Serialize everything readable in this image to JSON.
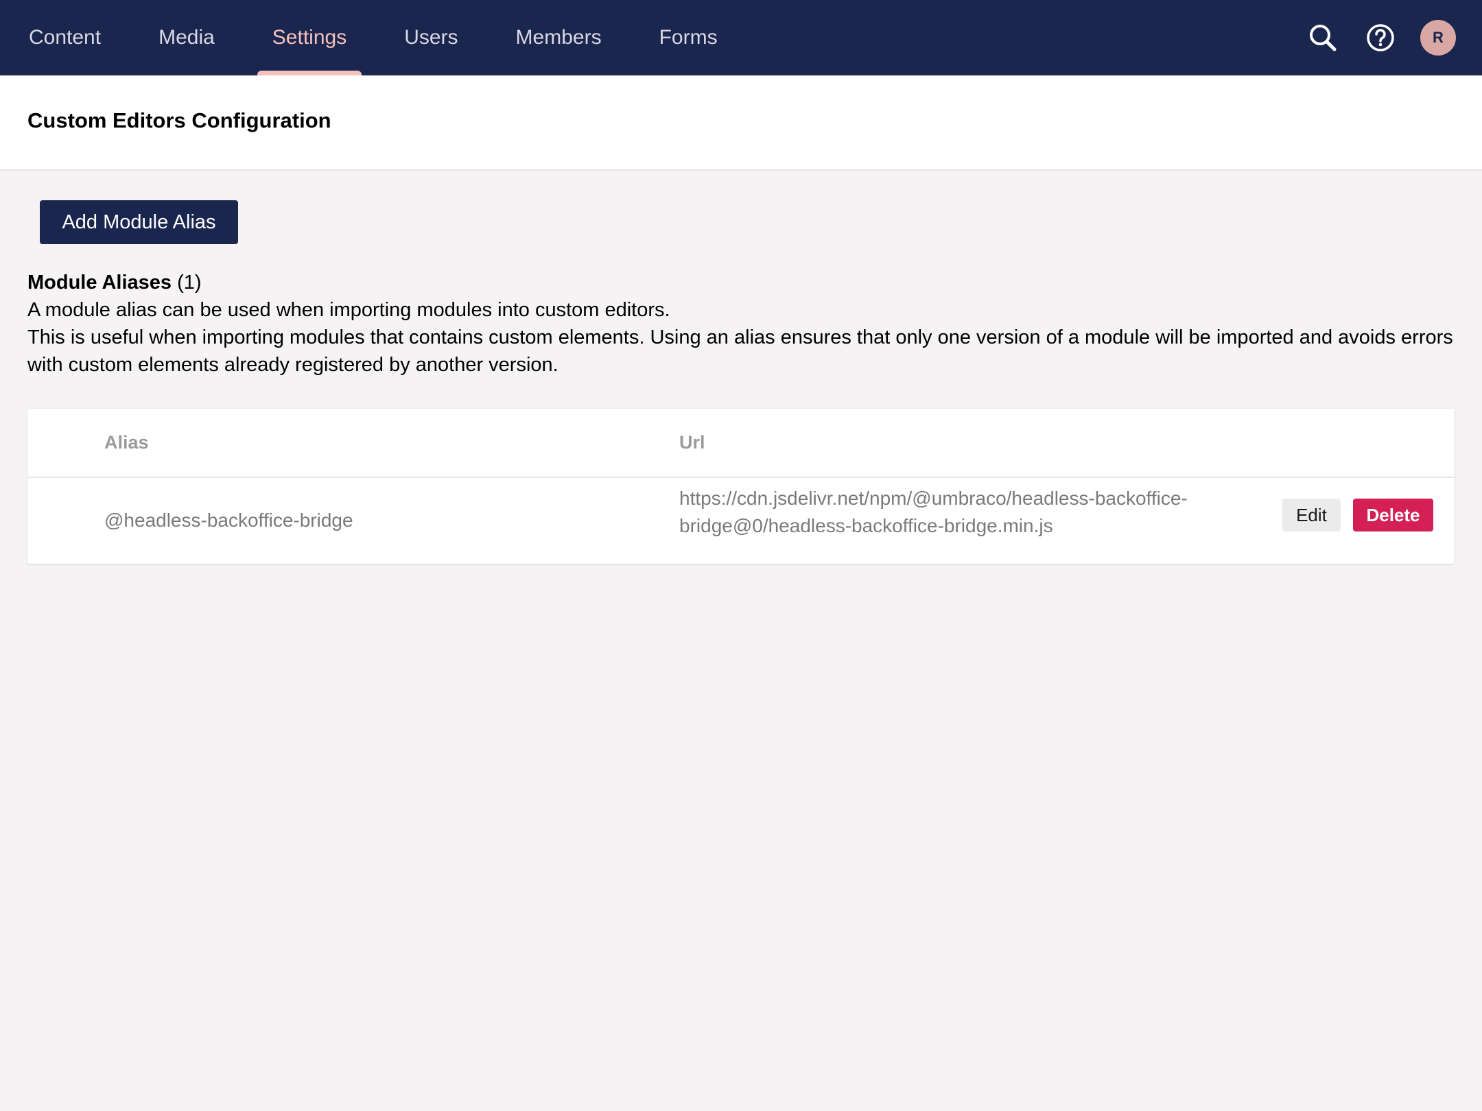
{
  "nav": {
    "items": [
      {
        "label": "Content"
      },
      {
        "label": "Media"
      },
      {
        "label": "Settings"
      },
      {
        "label": "Users"
      },
      {
        "label": "Members"
      },
      {
        "label": "Forms"
      }
    ],
    "active": "Settings"
  },
  "top_actions": {
    "search_icon": "search-icon",
    "help_icon": "help-icon",
    "avatar_initial": "R"
  },
  "header": {
    "title": "Custom Editors Configuration"
  },
  "toolbar": {
    "add_label": "Add Module Alias"
  },
  "section": {
    "heading": "Module Aliases",
    "count": "(1)",
    "description_1": "A module alias can be used when importing modules into custom editors.",
    "description_2": "This is useful when importing modules that contains custom elements. Using an alias ensures that only one version of a module will be imported and avoids errors with custom elements already registered by another version."
  },
  "table": {
    "columns": [
      "Alias",
      "Url"
    ],
    "rows": [
      {
        "alias": "@headless-backoffice-bridge",
        "url": "https://cdn.jsdelivr.net/npm/@umbraco/headless-backoffice-bridge@0/headless-backoffice-bridge.min.js",
        "edit_label": "Edit",
        "delete_label": "Delete"
      }
    ]
  },
  "colors": {
    "primary": "#1b264f",
    "accent": "#f5c1bc",
    "danger": "#d42054",
    "background": "#f5f3f3"
  }
}
